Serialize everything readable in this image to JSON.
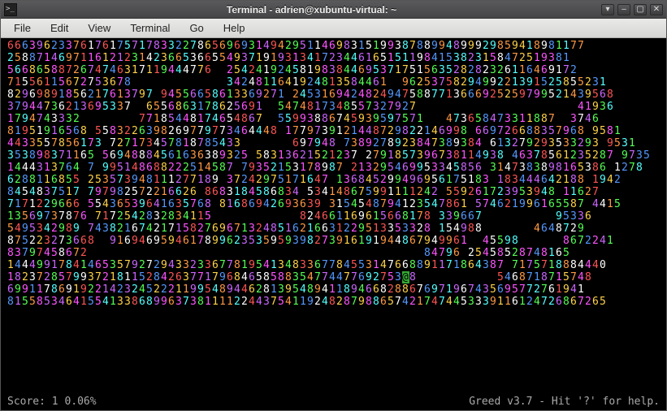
{
  "titlebar": {
    "title": "Terminal - adrien@xubuntu-virtual: ~"
  },
  "menu": {
    "items": [
      "File",
      "Edit",
      "View",
      "Terminal",
      "Go",
      "Help"
    ]
  },
  "window_controls": {
    "dropdown": "▾",
    "minimize": "–",
    "maximize": "▢",
    "close": "✕"
  },
  "game": {
    "cols": 88,
    "rows": [
      "6663962337617617571783322786569693149429511469831519938788994899929859418981177",
      "25887146971161212314236653665549371919313417234461651511984153823158472519381",
      "5668658872674746317119444776  254241924581983844695371751563528282326116469172",
      "71556115672753678             3424811641924813584461  9625375829499221391525855231",
      "82969891856217613797 94556658613369271 24531694248249475887713666925259799521439568",
      "37944736213695337  6556863178625691  5474817348557327927                      41936",
      "1794743332        77185448174654867  55993886745939597571   473658473311887  3746 ",
      "81951916568 5583226398269779773464448 1779739121448729822146998 669726688357968 9581",
      "4433557856173 727173457818785433       697948 7389278923847389384 613279293533293 9531",
      "353898371165 56948884561636389325 58313621521237 2791857396738114938 46378561235287 9735",
      "1444313764 7 995148688222514587 79352153178987 213295469953345856 3147383898165386 1278",
      "6288116855 253573948111277189 37242975171647 136845299496956175183 183444642188 1942",
      "8454837517 797982572216626 8683184586834 534148675991111242 559261723953948 11627",
      "7171229666 55436539641635768 81686942693639 3154548794123547861 574621996165587 4415",
      "13569737876 7172542832834115            824661169615668178 339667          95336",
      "5495342989 74382167421715827696713248516216631229513353328 154988       4648729",
      "875223273668  9169469594617899623535959398273916191944867949961  45598      8672241",
      "83797458672                                              84796 25458528748165",
      "14449917841465357927294332336778195413483367784553147668891171864387 7175718884440",
      "182372857993721811528426377179684658588354774477692753@8           5468718715748",
      "6991178691922142324522211995489446281395489411894668288676971967435695772761941",
      "8155853464155413386899637381111224437541192482879886574217474453339116124726867265"
    ],
    "status_left": "Score: 1  0.06%",
    "status_right": "Greed v3.7 - Hit '?' for help."
  }
}
